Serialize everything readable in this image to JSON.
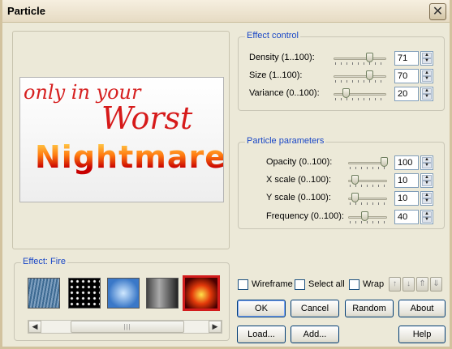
{
  "window": {
    "title": "Particle",
    "close_glyph": "✕"
  },
  "preview": {
    "art_line1": "only in your",
    "art_line2": "Worst",
    "art_line3": "Nightmare"
  },
  "effect": {
    "label": "Effect: Fire",
    "thumbnails": [
      "rain",
      "stars",
      "sky",
      "smoke",
      "fire"
    ],
    "selected": "fire",
    "scroll_grip": "|||"
  },
  "effect_control": {
    "title": "Effect control",
    "rows": [
      {
        "label": "Density (1..100):",
        "value": "71",
        "level": 71
      },
      {
        "label": "Size (1..100):",
        "value": "70",
        "level": 70
      },
      {
        "label": "Variance (0..100):",
        "value": "20",
        "level": 20
      }
    ]
  },
  "particle_parameters": {
    "title": "Particle parameters",
    "rows": [
      {
        "label": "Opacity (0..100):",
        "value": "100",
        "level": 100
      },
      {
        "label": "X scale (0..100):",
        "value": "10",
        "level": 10
      },
      {
        "label": "Y scale (0..100):",
        "value": "10",
        "level": 10
      },
      {
        "label": "Frequency (0..100):",
        "value": "40",
        "level": 40
      }
    ]
  },
  "options": {
    "wireframe": "Wireframe",
    "select_all": "Select all",
    "wrap": "Wrap"
  },
  "order_arrows": [
    "↑",
    "↓",
    "⇑",
    "⇓"
  ],
  "buttons": {
    "ok": "OK",
    "cancel": "Cancel",
    "random": "Random",
    "about": "About",
    "load": "Load...",
    "add": "Add...",
    "help": "Help"
  },
  "spinner_glyphs": {
    "up": "▲",
    "down": "▼"
  },
  "colors": {
    "group_title": "#1a47c6",
    "selection_border": "#d21c1c"
  }
}
